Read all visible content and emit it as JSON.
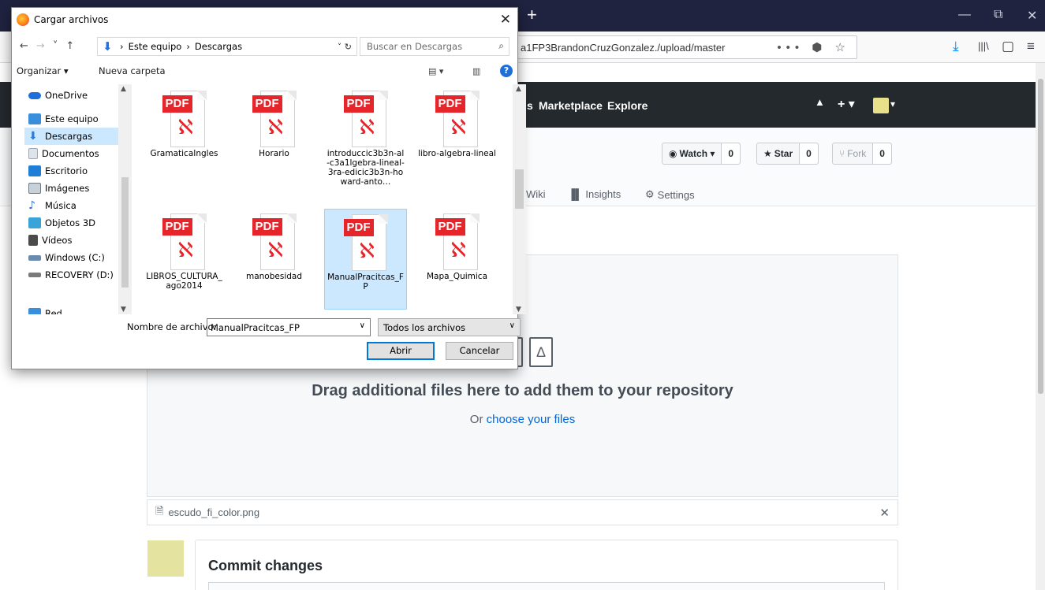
{
  "browser": {
    "url": "a1FP3BrandonCruzGonzalez./upload/master",
    "new_tab_symbol": "+",
    "window_controls": [
      "—",
      "⧉",
      "✕"
    ],
    "url_actions": "••• ⬢ ☆",
    "toolbar_icons": [
      "⤓",
      "|||\\",
      "▢",
      "≡"
    ]
  },
  "github": {
    "nav": {
      "prefix": "s",
      "marketplace": "Marketplace",
      "explore": "Explore"
    },
    "header_icons": {
      "bell": "🔔",
      "plus": "+ ▾",
      "avatar_caret": "▾"
    },
    "watch": {
      "label": "Watch ▾",
      "count": "0"
    },
    "star": {
      "label": "Star",
      "count": "0"
    },
    "fork": {
      "label": "Fork",
      "count": "0"
    },
    "tabs": {
      "wiki": "Wiki",
      "insights": "Insights",
      "settings": "Settings"
    },
    "dropzone": {
      "title": "Drag additional files here to add them to your repository",
      "sub_prefix": "Or ",
      "sub_link": "choose your files"
    },
    "uploaded_file": {
      "name": "escudo_fi_color.png",
      "remove": "✕"
    },
    "commit": {
      "title": "Commit changes"
    }
  },
  "dialog": {
    "title": "Cargar archivos",
    "close": "✕",
    "nav_arrows": [
      "←",
      "→",
      "˅",
      "↑"
    ],
    "breadcrumb": [
      "Este equipo",
      "Descargas"
    ],
    "breadcrumb_sep": "›",
    "breadcrumb_controls": "˅  ↻",
    "search_placeholder": "Buscar en Descargas",
    "organize": "Organizar ▾",
    "new_folder": "Nueva carpeta",
    "help": "?",
    "nav_items": [
      {
        "label": "OneDrive",
        "color": "#1e6fd9"
      },
      {
        "label": "Este equipo",
        "color": "#3a8fdc"
      },
      {
        "label": "Descargas",
        "color": "#2b7cd3"
      },
      {
        "label": "Documentos",
        "color": "#9ba7b4"
      },
      {
        "label": "Escritorio",
        "color": "#1f7fd6"
      },
      {
        "label": "Imágenes",
        "color": "#6c7b88"
      },
      {
        "label": "Música",
        "color": "#2d6bd0"
      },
      {
        "label": "Objetos 3D",
        "color": "#3aa3d8"
      },
      {
        "label": "Vídeos",
        "color": "#4b4b4b"
      },
      {
        "label": "Windows (C:)",
        "color": "#6a8ab0"
      },
      {
        "label": "RECOVERY (D:)",
        "color": "#7a7a7a"
      },
      {
        "label": "Red",
        "color": "#3a8fdc"
      }
    ],
    "files": [
      {
        "name": "GramaticaIngles",
        "type": "PDF"
      },
      {
        "name": "Horario",
        "type": "PDF"
      },
      {
        "name": "introduccic3b3n-al-c3a1lgebra-lineal-3ra-edicic3b3n-howard-anto…",
        "type": "PDF"
      },
      {
        "name": "libro-algebra-lineal",
        "type": "PDF"
      },
      {
        "name": "LIBROS_CULTURA_ago2014",
        "type": "PDF"
      },
      {
        "name": "manobesidad",
        "type": "PDF"
      },
      {
        "name": "ManualPracitcas_FP",
        "type": "PDF"
      },
      {
        "name": "Mapa_Quimica",
        "type": "PDF"
      }
    ],
    "filename_label": "Nombre de archivo:",
    "filename_value": "ManualPracitcas_FP",
    "filter_value": "Todos los archivos",
    "open_button": "Abrir",
    "cancel_button": "Cancelar"
  }
}
